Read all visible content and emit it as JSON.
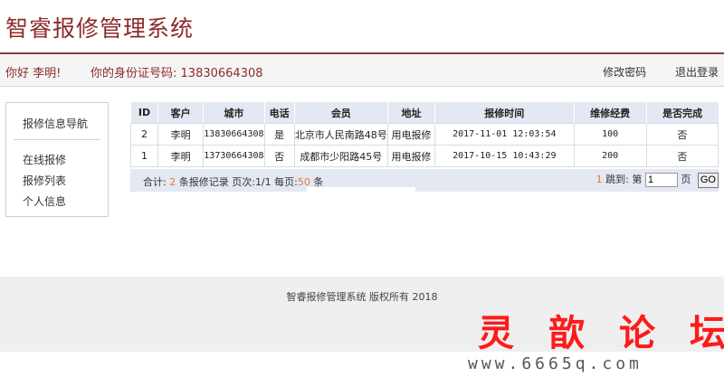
{
  "header": {
    "app_title": "智睿报修管理系统"
  },
  "userbar": {
    "greeting": "你好 李明!",
    "id_label": "你的身份证号码:",
    "id_value": "13830664308",
    "change_password": "修改密码",
    "logout": "退出登录"
  },
  "sidebar": {
    "heading": "报修信息导航",
    "items": [
      "在线报修",
      "报修列表",
      "个人信息"
    ]
  },
  "table": {
    "headers": [
      "ID",
      "客户",
      "城市",
      "电话",
      "会员",
      "地址",
      "报修时间",
      "维修经费",
      "是否完成"
    ],
    "rows": [
      [
        "2",
        "李明",
        "13830664308",
        "是",
        "北京市人民南路48号",
        "用电报修",
        "2017-11-01 12:03:54",
        "100",
        "否"
      ],
      [
        "1",
        "李明",
        "13730664308",
        "否",
        "成都市少阳路45号",
        "用电报修",
        "2017-10-15 10:43:29",
        "200",
        "否"
      ]
    ]
  },
  "pager": {
    "total_prefix": "合计:",
    "total_count": "2",
    "total_suffix": "条报修记录",
    "pages_label": "页次:",
    "pages_value": "1/1",
    "per_page_label": "每页:",
    "per_page_value": "50",
    "per_page_suffix": "条",
    "jump_count": "1",
    "jump_label": "跳到: 第",
    "jump_value": "1",
    "page_unit": "页",
    "go_label": "GO"
  },
  "footer": {
    "copyright": "智睿报修管理系统 版权所有   2018"
  },
  "watermark": {
    "title": "灵歆论坛",
    "url": "www.6665q.com"
  }
}
